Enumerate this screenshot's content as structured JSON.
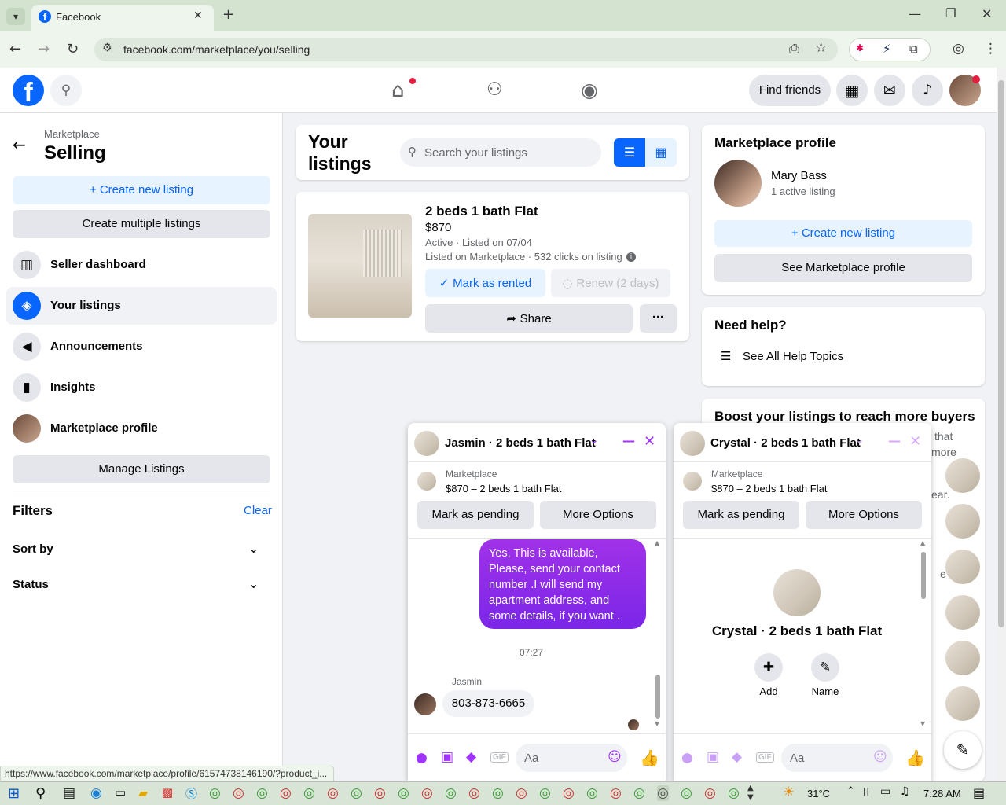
{
  "browser": {
    "tab_title": "Facebook",
    "url": "facebook.com/marketplace/you/selling",
    "status_url": "https://www.facebook.com/marketplace/profile/61574738146190/?product_i..."
  },
  "topnav": {
    "find_friends": "Find friends"
  },
  "left": {
    "breadcrumb": "Marketplace",
    "title": "Selling",
    "create_new": "+ Create new listing",
    "create_multiple": "Create multiple listings",
    "items": [
      {
        "label": "Seller dashboard",
        "icon": "dashboard-icon"
      },
      {
        "label": "Your listings",
        "icon": "tag-icon"
      },
      {
        "label": "Announcements",
        "icon": "megaphone-icon"
      },
      {
        "label": "Insights",
        "icon": "bar-chart-icon"
      },
      {
        "label": "Marketplace profile",
        "icon": "avatar"
      }
    ],
    "manage": "Manage Listings",
    "filters": "Filters",
    "clear": "Clear",
    "sort_by": "Sort by",
    "status": "Status"
  },
  "listings": {
    "heading_1": "Your",
    "heading_2": "listings",
    "search_placeholder": "Search your listings",
    "item": {
      "title": "2 beds 1 bath Flat",
      "price": "$870",
      "meta": "Active · Listed on 07/04",
      "clicks": "Listed on Marketplace · 532 clicks on listing",
      "mark_rented": "Mark as rented",
      "renew": "Renew (2 days)",
      "share": "Share",
      "more": "···"
    }
  },
  "profile": {
    "heading": "Marketplace profile",
    "name": "Mary Bass",
    "active": "1 active listing",
    "create_new": "+ Create new listing",
    "see_profile": "See Marketplace profile",
    "help_heading": "Need help?",
    "help_topics": "See All Help Topics",
    "boost_heading": "Boost your listings to reach more buyers",
    "boost_frag_1": "that",
    "boost_frag_2": "more",
    "boost_frag_3": "ear.",
    "boost_frag_4": "e"
  },
  "chat1": {
    "title": "Jasmin · 2 beds 1 bath Flat",
    "context_label": "Marketplace",
    "context_item": "$870 – 2 beds 1 bath Flat",
    "mark_pending": "Mark as pending",
    "more_options": "More Options",
    "sent_message": "Yes, This is  available, Please, send your contact number .I will send my apartment address, and some details, if you want .",
    "time": "07:27",
    "sender": "Jasmin",
    "received": "803-873-6665",
    "composer": "Aa"
  },
  "chat2": {
    "title": "Crystal · 2 beds 1 bath Flat",
    "context_label": "Marketplace",
    "context_item": "$870 – 2 beds 1 bath Flat",
    "mark_pending": "Mark as pending",
    "more_options": "More Options",
    "profile_name": "Crystal · 2 beds 1 bath Flat",
    "add": "Add",
    "name": "Name",
    "composer": "Aa"
  },
  "taskbar": {
    "temp": "31°C",
    "time": "7:28 AM"
  },
  "colors": {
    "brand": "#0866ff",
    "chat_accent": "#a033ff",
    "sent_bubble": "#8a2be2"
  }
}
